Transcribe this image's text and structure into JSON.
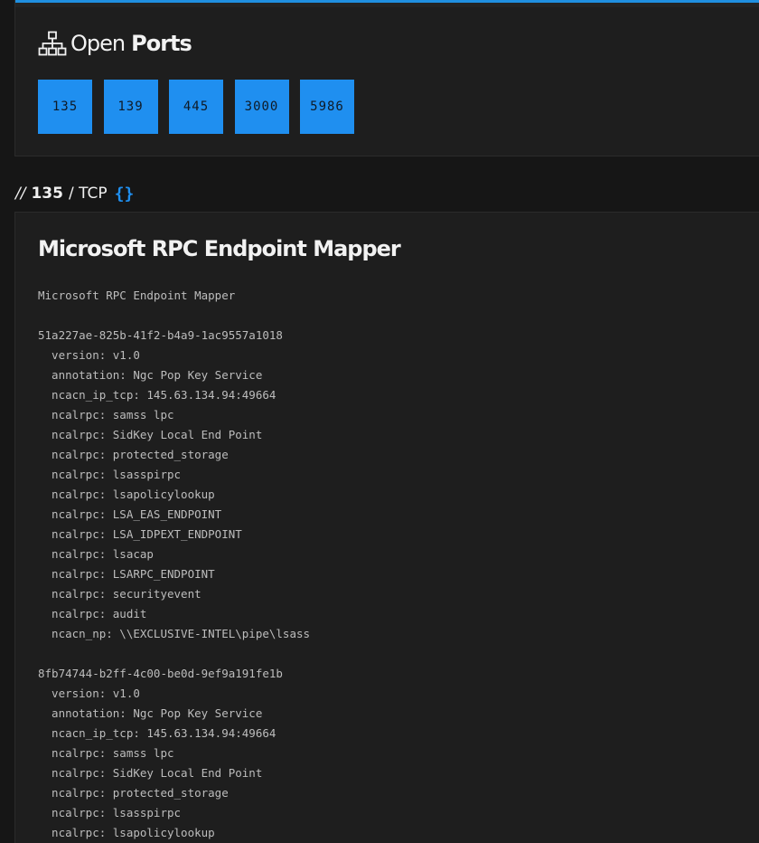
{
  "ports_section": {
    "title_light": "Open",
    "title_bold": "Ports",
    "icon": "sitemap-icon",
    "ports": [
      "135",
      "139",
      "445",
      "3000",
      "5986"
    ]
  },
  "service": {
    "slashes": "//",
    "port": "135",
    "protocol": "/ TCP",
    "braces": "{}",
    "title": "Microsoft RPC Endpoint Mapper",
    "banner": "Microsoft RPC Endpoint Mapper\n\n51a227ae-825b-41f2-b4a9-1ac9557a1018\n  version: v1.0\n  annotation: Ngc Pop Key Service\n  ncacn_ip_tcp: 145.63.134.94:49664\n  ncalrpc: samss lpc\n  ncalrpc: SidKey Local End Point\n  ncalrpc: protected_storage\n  ncalrpc: lsasspirpc\n  ncalrpc: lsapolicylookup\n  ncalrpc: LSA_EAS_ENDPOINT\n  ncalrpc: LSA_IDPEXT_ENDPOINT\n  ncalrpc: lsacap\n  ncalrpc: LSARPC_ENDPOINT\n  ncalrpc: securityevent\n  ncalrpc: audit\n  ncacn_np: \\\\EXCLUSIVE-INTEL\\pipe\\lsass\n\n8fb74744-b2ff-4c00-be0d-9ef9a191fe1b\n  version: v1.0\n  annotation: Ngc Pop Key Service\n  ncacn_ip_tcp: 145.63.134.94:49664\n  ncalrpc: samss lpc\n  ncalrpc: SidKey Local End Point\n  ncalrpc: protected_storage\n  ncalrpc: lsasspirpc\n  ncalrpc: lsapolicylookup"
  },
  "colors": {
    "accent": "#1f8ff0",
    "background": "#161616",
    "card": "#1e1e1e"
  }
}
